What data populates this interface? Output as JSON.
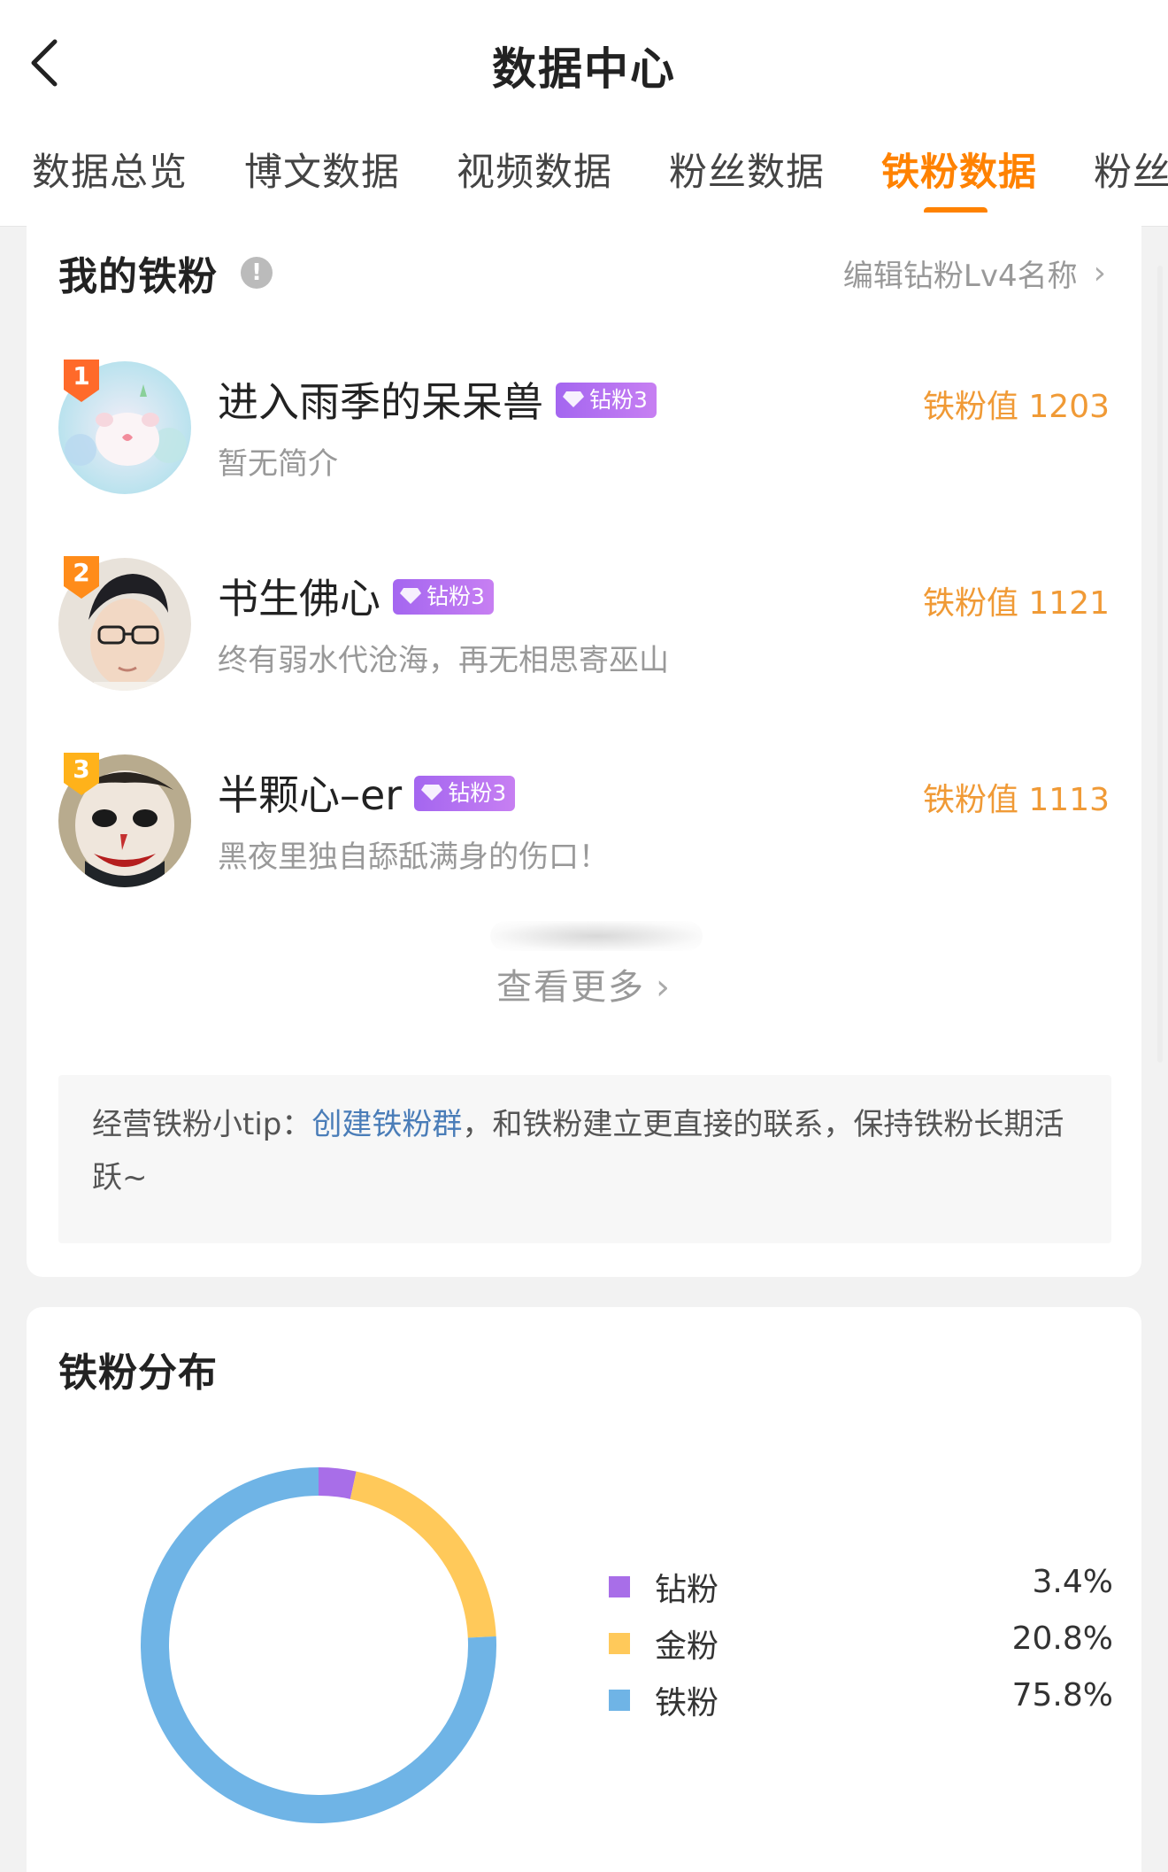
{
  "header": {
    "title": "数据中心",
    "tabs": [
      {
        "label": "数据总览"
      },
      {
        "label": "博文数据"
      },
      {
        "label": "视频数据"
      },
      {
        "label": "粉丝数据"
      },
      {
        "label": "铁粉数据"
      },
      {
        "label": "粉丝"
      }
    ],
    "active_tab": "铁粉数据",
    "accent_color": "#ff8200"
  },
  "my_fans": {
    "title": "我的铁粉",
    "info_icon": "info-icon",
    "edit_link": "编辑钻粉Lv4名称",
    "fans": [
      {
        "rank": "1",
        "name": "进入雨季的呆呆兽",
        "level": "钻粉3",
        "bio": "暂无简介",
        "score": "铁粉值 1203",
        "rank_color": "#ff6a2a"
      },
      {
        "rank": "2",
        "name": "书生佛心",
        "level": "钻粉3",
        "bio": "终有弱水代沧海，再无相思寄巫山",
        "score": "铁粉值 1121",
        "rank_color": "#ff8c1a"
      },
      {
        "rank": "3",
        "name": "半颗心–er",
        "level": "钻粉3",
        "bio": "黑夜里独自舔舐满身的伤口！",
        "score": "铁粉值 1113",
        "rank_color": "#ffb21a"
      }
    ],
    "view_more": "查看更多",
    "tip": {
      "prefix": "经营铁粉小tip：",
      "link": "创建铁粉群",
      "suffix": "，和铁粉建立更直接的联系，保持铁粉长期活跃~"
    }
  },
  "distribution": {
    "title": "铁粉分布"
  },
  "chart_data": {
    "type": "pie",
    "donut": true,
    "categories": [
      "钻粉",
      "金粉",
      "铁粉"
    ],
    "values": [
      3.4,
      20.8,
      75.8
    ],
    "labels": [
      "3.4%",
      "20.8%",
      "75.8%"
    ],
    "colors": [
      "#a86ee8",
      "#ffc95a",
      "#6fb4e6"
    ],
    "legend": "right"
  }
}
